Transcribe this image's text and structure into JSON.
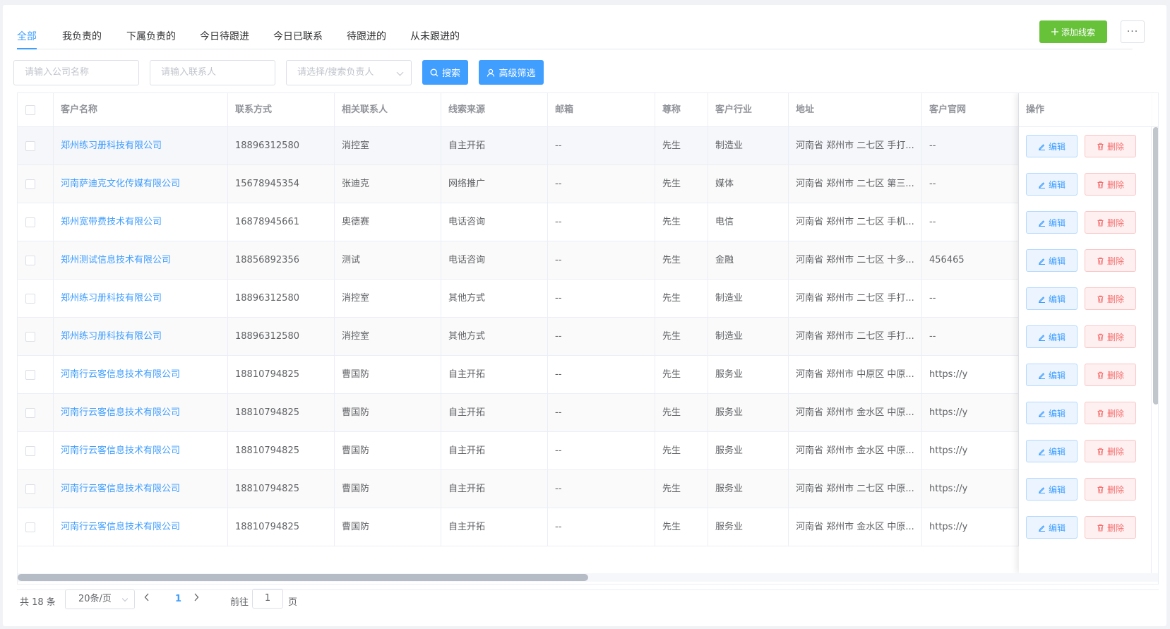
{
  "tabs": [
    {
      "label": "全部",
      "active": true
    },
    {
      "label": "我负责的"
    },
    {
      "label": "下属负责的"
    },
    {
      "label": "今日待跟进"
    },
    {
      "label": "今日已联系"
    },
    {
      "label": "待跟进的"
    },
    {
      "label": "从未跟进的"
    }
  ],
  "toolbar": {
    "add_label": "添加线索",
    "more_label": "···"
  },
  "filters": {
    "company_placeholder": "请输入公司名称",
    "contact_placeholder": "请输入联系人",
    "owner_placeholder": "请选择/搜索负责人",
    "search_label": "搜索",
    "advanced_label": "高级筛选"
  },
  "table": {
    "columns": [
      "客户名称",
      "联系方式",
      "相关联系人",
      "线索来源",
      "邮箱",
      "尊称",
      "客户行业",
      "地址",
      "客户官网",
      "操作"
    ],
    "rows": [
      {
        "name": "郑州练习册科技有限公司",
        "phone": "18896312580",
        "contact": "消控室",
        "source": "自主开拓",
        "email": "--",
        "title": "先生",
        "industry": "制造业",
        "address": "河南省 郑州市 二七区 手打...",
        "website": "--"
      },
      {
        "name": "河南萨迪克文化传媒有限公司",
        "phone": "15678945354",
        "contact": "张迪克",
        "source": "网络推广",
        "email": "--",
        "title": "先生",
        "industry": "媒体",
        "address": "河南省 郑州市 二七区 第三...",
        "website": "--"
      },
      {
        "name": "郑州宽带费技术有限公司",
        "phone": "16878945661",
        "contact": "奥德赛",
        "source": "电话咨询",
        "email": "--",
        "title": "先生",
        "industry": "电信",
        "address": "河南省 郑州市 二七区 手机...",
        "website": "--"
      },
      {
        "name": "郑州测试信息技术有限公司",
        "phone": "18856892356",
        "contact": "测试",
        "source": "电话咨询",
        "email": "--",
        "title": "先生",
        "industry": "金融",
        "address": "河南省 郑州市 二七区 十多...",
        "website": "456465"
      },
      {
        "name": "郑州练习册科技有限公司",
        "phone": "18896312580",
        "contact": "消控室",
        "source": "其他方式",
        "email": "--",
        "title": "先生",
        "industry": "制造业",
        "address": "河南省 郑州市 二七区 手打...",
        "website": "--"
      },
      {
        "name": "郑州练习册科技有限公司",
        "phone": "18896312580",
        "contact": "消控室",
        "source": "其他方式",
        "email": "--",
        "title": "先生",
        "industry": "制造业",
        "address": "河南省 郑州市 二七区 手打...",
        "website": "--"
      },
      {
        "name": "河南行云客信息技术有限公司",
        "phone": "18810794825",
        "contact": "曹国防",
        "source": "自主开拓",
        "email": "--",
        "title": "先生",
        "industry": "服务业",
        "address": "河南省 郑州市 中原区 中原...",
        "website": "https://y"
      },
      {
        "name": "河南行云客信息技术有限公司",
        "phone": "18810794825",
        "contact": "曹国防",
        "source": "自主开拓",
        "email": "--",
        "title": "先生",
        "industry": "服务业",
        "address": "河南省 郑州市 金水区 中原...",
        "website": "https://y"
      },
      {
        "name": "河南行云客信息技术有限公司",
        "phone": "18810794825",
        "contact": "曹国防",
        "source": "自主开拓",
        "email": "--",
        "title": "先生",
        "industry": "服务业",
        "address": "河南省 郑州市 金水区 中原...",
        "website": "https://y"
      },
      {
        "name": "河南行云客信息技术有限公司",
        "phone": "18810794825",
        "contact": "曹国防",
        "source": "自主开拓",
        "email": "--",
        "title": "先生",
        "industry": "服务业",
        "address": "河南省 郑州市 二七区 中原...",
        "website": "https://y"
      },
      {
        "name": "河南行云客信息技术有限公司",
        "phone": "18810794825",
        "contact": "曹国防",
        "source": "自主开拓",
        "email": "--",
        "title": "先生",
        "industry": "服务业",
        "address": "河南省 郑州市 金水区 中原...",
        "website": "https://y"
      }
    ],
    "edit_label": "编辑",
    "delete_label": "删除"
  },
  "pagination": {
    "total": "共 18 条",
    "page_size": "20条/页",
    "current_page": "1",
    "goto_label": "前往",
    "goto_value": "1",
    "page_suffix": "页"
  },
  "colors": {
    "primary": "#409eff",
    "success": "#67c23a",
    "danger": "#f56c6c"
  }
}
